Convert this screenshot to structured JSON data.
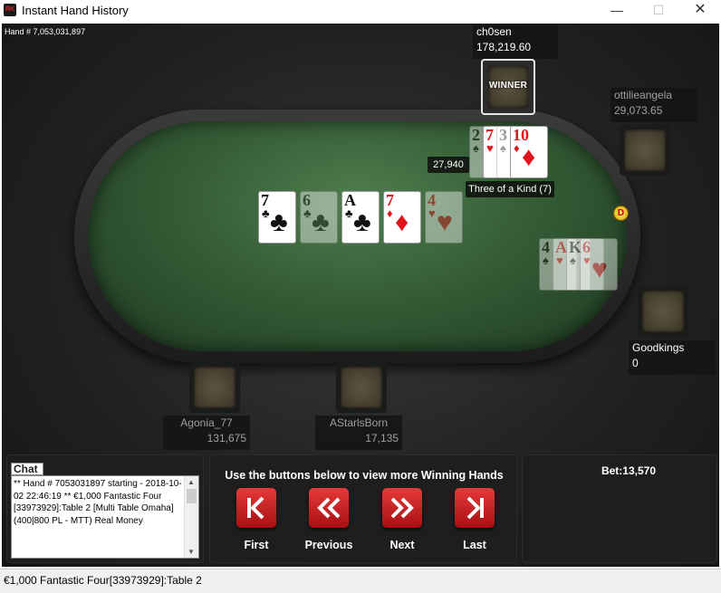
{
  "window": {
    "app_icon_text": "RK",
    "title": "Instant Hand History",
    "minimize_glyph": "—",
    "maximize_glyph": "☐",
    "close_glyph": "✕"
  },
  "hand_number": "Hand # 7,053,031,897",
  "players": {
    "ch0sen": {
      "name": "ch0sen",
      "stack": "178,219.60",
      "winner_label": "WINNER",
      "bet": "27,940",
      "hand_rank": "Three of a Kind (7)"
    },
    "ottilie": {
      "name": "ottilieangela",
      "stack": "29,073.65"
    },
    "goodkings": {
      "name": "Goodkings",
      "stack": "0"
    },
    "agonia": {
      "name": "Agonia_77",
      "stack": "131,675"
    },
    "astarls": {
      "name": "AStarlsBorn",
      "stack": "17,135"
    }
  },
  "dealer_button": "D",
  "board": [
    {
      "rank": "7",
      "suit": "♣",
      "color": "black",
      "dim": false
    },
    {
      "rank": "6",
      "suit": "♣",
      "color": "black",
      "dim": true
    },
    {
      "rank": "A",
      "suit": "♣",
      "color": "black",
      "dim": false
    },
    {
      "rank": "7",
      "suit": "♦",
      "color": "red",
      "dim": false
    },
    {
      "rank": "4",
      "suit": "♥",
      "color": "red",
      "dim": true
    }
  ],
  "winner_hole_cards": [
    {
      "rank": "2",
      "suit": "♠",
      "color": "black",
      "dim": true
    },
    {
      "rank": "7",
      "suit": "♥",
      "color": "red",
      "dim": false
    },
    {
      "rank": "3",
      "suit": "♠",
      "color": "black",
      "dim": true
    },
    {
      "rank": "10",
      "suit": "♦",
      "color": "red",
      "dim": false
    }
  ],
  "goodkings_hole_cards": [
    {
      "rank": "4",
      "suit": "♠",
      "color": "black",
      "dim": true
    },
    {
      "rank": "A",
      "suit": "♥",
      "color": "red",
      "dim": true
    },
    {
      "rank": "K",
      "suit": "♠",
      "color": "black",
      "dim": true
    },
    {
      "rank": "6",
      "suit": "♥",
      "color": "red",
      "dim": true
    }
  ],
  "chat": {
    "label": "Chat",
    "text": "** Hand # 7053031897 starting - 2018-10-02 22:46:19 ** €1,000 Fantastic Four [33973929]:Table 2 [Multi Table Omaha] (400|800 PL - MTT) Real Money"
  },
  "nav": {
    "title": "Use the buttons below to view more Winning Hands",
    "first": "First",
    "previous": "Previous",
    "next": "Next",
    "last": "Last"
  },
  "bet_panel": {
    "text": "Bet:13,570"
  },
  "status_bar": {
    "text": "€1,000 Fantastic Four[33973929]:Table 2"
  }
}
